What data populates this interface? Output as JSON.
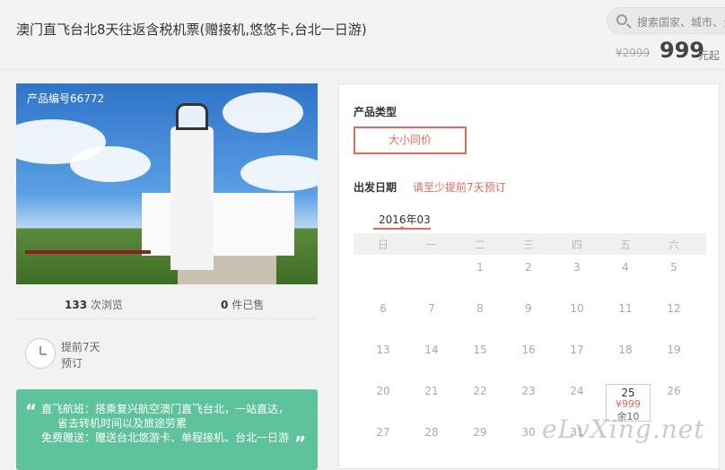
{
  "product": {
    "title": "澳门直飞台北8天往返含税机票(赠接机,悠悠卡,台北一日游)",
    "original_price": "¥2999",
    "price": "999",
    "price_unit": "元起",
    "product_number": "产品编号66772"
  },
  "search": {
    "placeholder": "搜索国家、城市、景点"
  },
  "stats": {
    "views_count": "133",
    "views_label": "次浏览",
    "sold_count": "0",
    "sold_label": "件已售"
  },
  "advance": {
    "line1": "提前7天",
    "line2": "预订"
  },
  "promo": {
    "lines": [
      "直飞航班：搭乘复兴航空澳门直飞台北，一站直达，",
      "省去转机时间以及旅途劳累",
      "免费赠送：赠送台北悠游卡、单程接机、台北一日游"
    ]
  },
  "booking": {
    "type_heading": "产品类型",
    "type_option": "大小同价",
    "date_heading": "出发日期",
    "date_note": "请至少提前7天预订",
    "month": "2016年03",
    "weekdays": [
      "日",
      "一",
      "二",
      "三",
      "四",
      "五",
      "六"
    ],
    "weeks": [
      [
        "",
        "",
        "1",
        "2",
        "3",
        "4",
        "5"
      ],
      [
        "6",
        "7",
        "8",
        "9",
        "10",
        "11",
        "12"
      ],
      [
        "13",
        "14",
        "15",
        "16",
        "17",
        "18",
        "19"
      ],
      [
        "20",
        "21",
        "22",
        "23",
        "24",
        "",
        "26"
      ],
      [
        "27",
        "28",
        "29",
        "30",
        "31",
        "",
        ""
      ]
    ],
    "selected": {
      "day": "25",
      "price": "¥999",
      "remaining": "余10"
    }
  },
  "watermark": "eLvXing.net",
  "colors": {
    "accent": "#e06a5c",
    "promo_bg": "#5ec39b"
  }
}
